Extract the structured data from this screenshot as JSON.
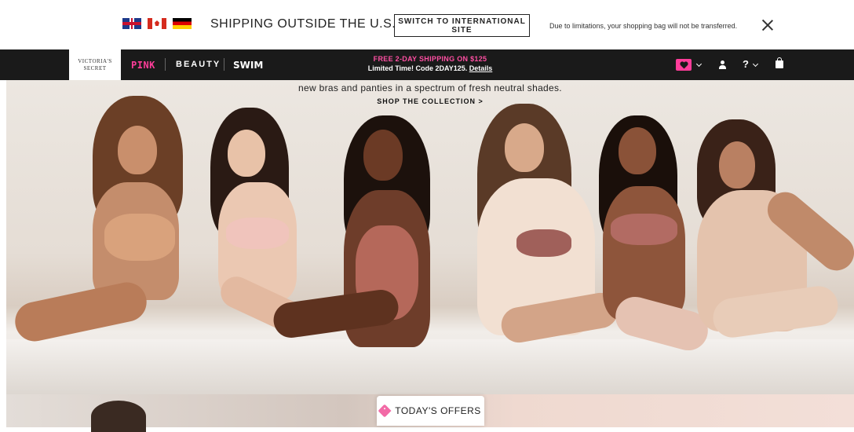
{
  "intl_bar": {
    "flags": [
      "uk-flag-icon",
      "canada-flag-icon",
      "germany-flag-icon"
    ],
    "question": "SHIPPING OUTSIDE THE U.S.?",
    "switch_label": "SWITCH TO INTERNATIONAL SITE",
    "note": "Due to limitations, your shopping bag will not be transferred.",
    "close_icon": "close-icon"
  },
  "nav": {
    "logo_line1": "VICTORIA'S",
    "logo_line2": "SECRET",
    "links": [
      "PINK",
      "BEAUTY",
      "SWIM"
    ],
    "promo_line1": "FREE 2-DAY SHIPPING ON $125",
    "promo_line2": "Limited Time! Code 2DAY125.",
    "promo_details": "Details",
    "icons": [
      "heart-icon",
      "user-icon",
      "help-icon",
      "bag-icon"
    ],
    "help_glyph": "?",
    "accent_color": "#ff3d9a"
  },
  "hero": {
    "subtitle": "new bras and panties in a spectrum of fresh neutral shades.",
    "cta": "SHOP THE COLLECTION >"
  },
  "offers": {
    "label": "TODAY'S OFFERS",
    "icon": "tag-icon"
  }
}
